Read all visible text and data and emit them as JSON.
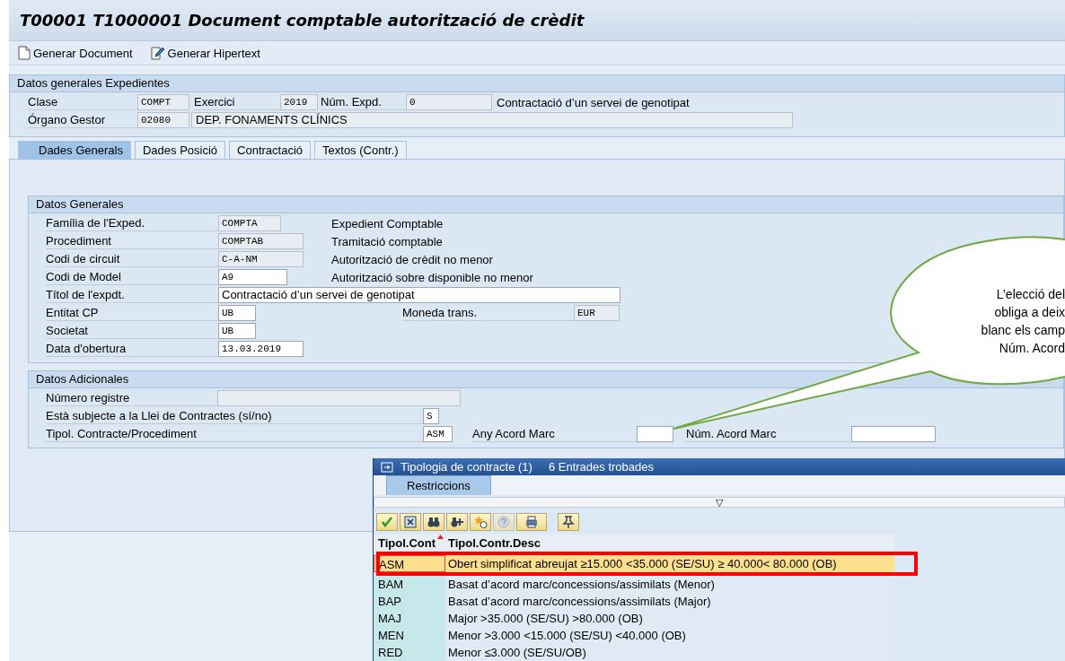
{
  "window": {
    "title": "T00001 T1000001 Document comptable autorització de crèdit"
  },
  "toolbar": [
    {
      "kind": "document",
      "label": "Generar Document"
    },
    {
      "kind": "edit",
      "label": "Generar Hipertext"
    }
  ],
  "header": {
    "title": "Datos generales Expedientes",
    "rows": [
      [
        {
          "kind": "label",
          "text": "Clase"
        },
        {
          "kind": "field",
          "value": "COMPT",
          "disabled": true
        },
        {
          "kind": "label",
          "text": "Exercici"
        },
        {
          "kind": "field",
          "value": "2019",
          "disabled": true
        },
        {
          "kind": "label",
          "text": "Núm. Expd."
        },
        {
          "kind": "field",
          "value": "0",
          "disabled": true
        },
        {
          "kind": "text",
          "text": "Contractació d’un servei de genotipat"
        }
      ],
      [
        {
          "kind": "label",
          "text": "Órgano Gestor"
        },
        {
          "kind": "field",
          "value": "02080",
          "disabled": true
        },
        {
          "kind": "display",
          "text": "DEP. FONAMENTS CLÍNICS"
        }
      ]
    ]
  },
  "tabs": [
    {
      "label": "Dades Generals",
      "selected": true
    },
    {
      "label": "Dades Posició",
      "selected": false
    },
    {
      "label": "Contractació",
      "selected": false
    },
    {
      "label": "Textos (Contr.)",
      "selected": false
    }
  ],
  "groups": [
    {
      "title": "Datos Generales",
      "rows": [
        [
          {
            "kind": "label",
            "text": "Família de l'Exped."
          },
          {
            "kind": "field",
            "value": "COMPTA",
            "disabled": true
          },
          {
            "kind": "text",
            "text": "Expedient Comptable"
          }
        ],
        [
          {
            "kind": "label",
            "text": "Procediment"
          },
          {
            "kind": "field",
            "value": "COMPTAB",
            "disabled": true
          },
          {
            "kind": "text",
            "text": "Tramitació comptable"
          }
        ],
        [
          {
            "kind": "label",
            "text": "Codi de circuit"
          },
          {
            "kind": "field",
            "value": "C-A-NM",
            "disabled": true
          },
          {
            "kind": "text",
            "text": "Autorització de crèdit no menor"
          }
        ],
        [
          {
            "kind": "label",
            "text": "Codi de Model"
          },
          {
            "kind": "field",
            "value": "A9",
            "disabled": false
          },
          {
            "kind": "text",
            "text": "Autorització sobre disponible no menor"
          }
        ],
        [
          {
            "kind": "label",
            "text": "Títol de l'expdt."
          },
          {
            "kind": "textfield",
            "value": "Contractació d’un servei de genotipat",
            "disabled": false
          }
        ],
        [
          {
            "kind": "label",
            "text": "Entitat CP"
          },
          {
            "kind": "field",
            "value": "UB",
            "disabled": false
          },
          {
            "kind": "label",
            "text": "Moneda trans."
          },
          {
            "kind": "field",
            "value": "EUR",
            "disabled": true
          }
        ],
        [
          {
            "kind": "label",
            "text": "Societat"
          },
          {
            "kind": "field",
            "value": "UB",
            "disabled": false
          }
        ],
        [
          {
            "kind": "label",
            "text": "Data d'obertura"
          },
          {
            "kind": "field",
            "value": "13.03.2019",
            "disabled": false
          }
        ]
      ]
    },
    {
      "title": "Datos Adicionales",
      "rows": [
        [
          {
            "kind": "label",
            "text": "Número registre"
          },
          {
            "kind": "field",
            "disabled": true
          }
        ],
        [
          {
            "kind": "label",
            "text": "Està subjecte a la Llei de Contractes (sí/no)"
          },
          {
            "kind": "field",
            "value": "S",
            "disabled": false
          }
        ],
        [
          {
            "kind": "label",
            "text": "Tipol. Contracte/Procediment"
          },
          {
            "kind": "field",
            "value": "ASM",
            "disabled": false
          },
          {
            "kind": "label",
            "text": "Any Acord Marc"
          },
          {
            "kind": "field",
            "disabled": false
          },
          {
            "kind": "label",
            "text": "Núm. Acord Marc"
          },
          {
            "kind": "field",
            "disabled": false
          }
        ]
      ]
    }
  ],
  "popup": {
    "title": "Tipologia de contracte (1)",
    "count": "6 Entrades trobades",
    "tabs": [
      {
        "label": "Restriccions",
        "selected": true
      }
    ],
    "toggle": "▽",
    "buttons": [
      {
        "kind": "check",
        "disabled": false
      },
      {
        "kind": "cancel",
        "disabled": false
      },
      {
        "kind": "find",
        "disabled": false
      },
      {
        "kind": "findnext",
        "disabled": false
      },
      {
        "kind": "new",
        "disabled": false
      },
      {
        "kind": "help",
        "disabled": true
      },
      {
        "kind": "print",
        "disabled": false
      },
      {
        "kind": "pin",
        "disabled": false
      }
    ],
    "columns": [
      {
        "label": "Tipol.Cont",
        "sorted": true
      },
      {
        "label": "Tipol.Contr.Desc",
        "sorted": false
      }
    ],
    "rows": [
      {
        "code": "ASM",
        "desc": "Obert simplificat abreujat ≥15.000 <35.000 (SE/SU) ≥ 40.000< 80.000 (OB)",
        "selected": true,
        "highlighted": true
      },
      {
        "code": "BAM",
        "desc": "Basat d’acord marc/concessions/assimilats (Menor)",
        "selected": false,
        "highlighted": false
      },
      {
        "code": "BAP",
        "desc": "Basat d’acord marc/concessions/assimilats (Major)",
        "selected": false,
        "highlighted": false
      },
      {
        "code": "MAJ",
        "desc": "Major >35.000 (SE/SU) >80.000 (OB)",
        "selected": false,
        "highlighted": false
      },
      {
        "code": "MEN",
        "desc": "Menor >3.000 <15.000 (SE/SU)  <40.000 (OB)",
        "selected": false,
        "highlighted": false
      },
      {
        "code": "RED",
        "desc": "Menor  ≤3.000  (SE/SU/OB)",
        "selected": false,
        "highlighted": false
      }
    ]
  },
  "callout": {
    "lines": [
      "L’elecció del",
      "obliga a deix",
      "blanc els camp",
      "Núm. Acord"
    ]
  }
}
